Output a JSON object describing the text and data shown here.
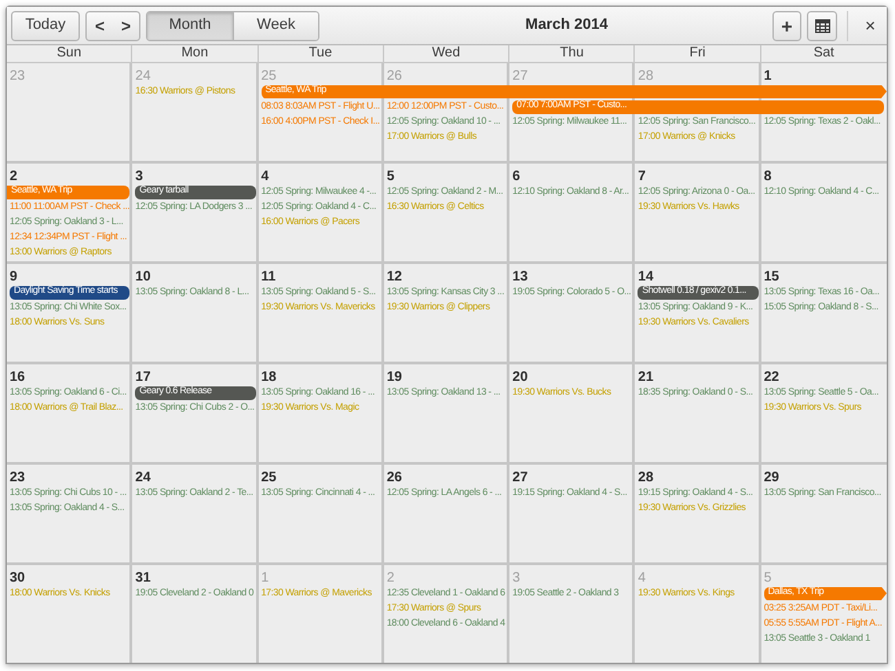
{
  "toolbar": {
    "today": "Today",
    "prev": "<",
    "next": ">",
    "views": [
      {
        "label": "Month",
        "selected": true
      },
      {
        "label": "Week",
        "selected": false
      }
    ],
    "title": "March 2014",
    "add": "+",
    "close": "×"
  },
  "weekdays": [
    "Sun",
    "Mon",
    "Tue",
    "Wed",
    "Thu",
    "Fri",
    "Sat"
  ],
  "weeks": [
    {
      "days": [
        {
          "date": "23",
          "in_month": false
        },
        {
          "date": "24",
          "in_month": false,
          "events": [
            {
              "kind": "line",
              "text": "16:30 Warriors @ Pistons",
              "color": "#c4a000"
            }
          ]
        },
        {
          "date": "25",
          "in_month": false,
          "events": [
            {
              "kind": "bar",
              "text": "Seattle, WA Trip",
              "color": "#f57900",
              "open_left": false,
              "arrow_right": true
            },
            {
              "kind": "line",
              "text": "08:03 8:03AM PST - Flight U...",
              "color": "#f57900"
            },
            {
              "kind": "line",
              "text": "16:00 4:00PM PST - Check I...",
              "color": "#f57900"
            }
          ]
        },
        {
          "date": "26",
          "in_month": false,
          "events": [
            {
              "kind": "continued"
            },
            {
              "kind": "line",
              "text": "12:00 12:00PM PST - Custo...",
              "color": "#f57900"
            },
            {
              "kind": "line",
              "text": "12:05 Spring: Oakland 10 - ...",
              "color": "#5f8c5f"
            },
            {
              "kind": "line",
              "text": "17:00 Warriors @ Bulls",
              "color": "#c4a000"
            }
          ]
        },
        {
          "date": "27",
          "in_month": false,
          "events": [
            {
              "kind": "continued"
            },
            {
              "kind": "bar",
              "text": "07:00 7:00AM PST - Custo...",
              "color": "#f57900",
              "open_left": false,
              "arrow_right": false
            },
            {
              "kind": "line",
              "text": "12:05 Spring: Milwaukee 11...",
              "color": "#5f8c5f"
            }
          ]
        },
        {
          "date": "28",
          "in_month": false,
          "events": [
            {
              "kind": "continued"
            },
            {
              "kind": "continued"
            },
            {
              "kind": "line",
              "text": "12:05 Spring: San Francisco...",
              "color": "#5f8c5f"
            },
            {
              "kind": "line",
              "text": "17:00 Warriors @ Knicks",
              "color": "#c4a000"
            }
          ]
        },
        {
          "date": "1",
          "in_month": true,
          "events": [
            {
              "kind": "continued"
            },
            {
              "kind": "continued"
            },
            {
              "kind": "line",
              "text": "12:05 Spring: Texas 2 - Oakl...",
              "color": "#5f8c5f"
            }
          ]
        }
      ]
    },
    {
      "days": [
        {
          "date": "2",
          "in_month": true,
          "events": [
            {
              "kind": "bar",
              "text": "Seattle, WA Trip",
              "color": "#f57900",
              "open_left": true,
              "arrow_right": false
            },
            {
              "kind": "line",
              "text": "11:00 11:00AM PST - Check ...",
              "color": "#f57900"
            },
            {
              "kind": "line",
              "text": "12:05 Spring: Oakland 3 - L...",
              "color": "#5f8c5f"
            },
            {
              "kind": "line",
              "text": "12:34 12:34PM PST - Flight ...",
              "color": "#f57900"
            },
            {
              "kind": "line",
              "text": "13:00 Warriors @ Raptors",
              "color": "#c4a000"
            }
          ]
        },
        {
          "date": "3",
          "in_month": true,
          "events": [
            {
              "kind": "bar",
              "text": "Geary tarball",
              "color": "#555753",
              "open_left": false,
              "arrow_right": false
            },
            {
              "kind": "line",
              "text": "12:05 Spring: LA Dodgers 3 ...",
              "color": "#5f8c5f"
            }
          ]
        },
        {
          "date": "4",
          "in_month": true,
          "events": [
            {
              "kind": "line",
              "text": "12:05 Spring: Milwaukee 4 -...",
              "color": "#5f8c5f"
            },
            {
              "kind": "line",
              "text": "12:05 Spring: Oakland 4 - C...",
              "color": "#5f8c5f"
            },
            {
              "kind": "line",
              "text": "16:00 Warriors @ Pacers",
              "color": "#c4a000"
            }
          ]
        },
        {
          "date": "5",
          "in_month": true,
          "events": [
            {
              "kind": "line",
              "text": "12:05 Spring: Oakland 2 - M...",
              "color": "#5f8c5f"
            },
            {
              "kind": "line",
              "text": "16:30 Warriors @ Celtics",
              "color": "#c4a000"
            }
          ]
        },
        {
          "date": "6",
          "in_month": true,
          "events": [
            {
              "kind": "line",
              "text": "12:10 Spring: Oakland 8 - Ar...",
              "color": "#5f8c5f"
            }
          ]
        },
        {
          "date": "7",
          "in_month": true,
          "events": [
            {
              "kind": "line",
              "text": "12:05 Spring: Arizona 0 - Oa...",
              "color": "#5f8c5f"
            },
            {
              "kind": "line",
              "text": "19:30 Warriors Vs. Hawks",
              "color": "#c4a000"
            }
          ]
        },
        {
          "date": "8",
          "in_month": true,
          "events": [
            {
              "kind": "line",
              "text": "12:10 Spring: Oakland 4 - C...",
              "color": "#5f8c5f"
            }
          ]
        }
      ]
    },
    {
      "days": [
        {
          "date": "9",
          "in_month": true,
          "events": [
            {
              "kind": "bar",
              "text": "Daylight Saving Time starts",
              "color": "#204a87",
              "open_left": false,
              "arrow_right": false
            },
            {
              "kind": "line",
              "text": "13:05 Spring: Chi White Sox...",
              "color": "#5f8c5f"
            },
            {
              "kind": "line",
              "text": "18:00 Warriors Vs. Suns",
              "color": "#c4a000"
            }
          ]
        },
        {
          "date": "10",
          "in_month": true,
          "events": [
            {
              "kind": "line",
              "text": "13:05 Spring: Oakland 8 - L...",
              "color": "#5f8c5f"
            }
          ]
        },
        {
          "date": "11",
          "in_month": true,
          "events": [
            {
              "kind": "line",
              "text": "13:05 Spring: Oakland 5 - S...",
              "color": "#5f8c5f"
            },
            {
              "kind": "line",
              "text": "19:30 Warriors Vs. Mavericks",
              "color": "#c4a000"
            }
          ]
        },
        {
          "date": "12",
          "in_month": true,
          "events": [
            {
              "kind": "line",
              "text": "13:05 Spring: Kansas City 3 ...",
              "color": "#5f8c5f"
            },
            {
              "kind": "line",
              "text": "19:30 Warriors @ Clippers",
              "color": "#c4a000"
            }
          ]
        },
        {
          "date": "13",
          "in_month": true,
          "events": [
            {
              "kind": "line",
              "text": "19:05 Spring: Colorado 5 - O...",
              "color": "#5f8c5f"
            }
          ]
        },
        {
          "date": "14",
          "in_month": true,
          "events": [
            {
              "kind": "bar",
              "text": "Shotwell 0.18 / gexiv2 0.1...",
              "color": "#555753",
              "open_left": false,
              "arrow_right": false
            },
            {
              "kind": "line",
              "text": "13:05 Spring: Oakland 9 - K...",
              "color": "#5f8c5f"
            },
            {
              "kind": "line",
              "text": "19:30 Warriors Vs. Cavaliers",
              "color": "#c4a000"
            }
          ]
        },
        {
          "date": "15",
          "in_month": true,
          "events": [
            {
              "kind": "line",
              "text": "13:05 Spring: Texas 16 - Oa...",
              "color": "#5f8c5f"
            },
            {
              "kind": "line",
              "text": "15:05 Spring: Oakland 8 - S...",
              "color": "#5f8c5f"
            }
          ]
        }
      ]
    },
    {
      "days": [
        {
          "date": "16",
          "in_month": true,
          "events": [
            {
              "kind": "line",
              "text": "13:05 Spring: Oakland 6 - Ci...",
              "color": "#5f8c5f"
            },
            {
              "kind": "line",
              "text": "18:00 Warriors @ Trail Blaz...",
              "color": "#c4a000"
            }
          ]
        },
        {
          "date": "17",
          "in_month": true,
          "events": [
            {
              "kind": "bar",
              "text": "Geary 0.6 Release",
              "color": "#555753",
              "open_left": false,
              "arrow_right": false
            },
            {
              "kind": "line",
              "text": "13:05 Spring: Chi Cubs 2 - O...",
              "color": "#5f8c5f"
            }
          ]
        },
        {
          "date": "18",
          "in_month": true,
          "events": [
            {
              "kind": "line",
              "text": "13:05 Spring: Oakland 16 - ...",
              "color": "#5f8c5f"
            },
            {
              "kind": "line",
              "text": "19:30 Warriors Vs. Magic",
              "color": "#c4a000"
            }
          ]
        },
        {
          "date": "19",
          "in_month": true,
          "events": [
            {
              "kind": "line",
              "text": "13:05 Spring: Oakland 13 - ...",
              "color": "#5f8c5f"
            }
          ]
        },
        {
          "date": "20",
          "in_month": true,
          "events": [
            {
              "kind": "line",
              "text": "19:30 Warriors Vs. Bucks",
              "color": "#c4a000"
            }
          ]
        },
        {
          "date": "21",
          "in_month": true,
          "events": [
            {
              "kind": "line",
              "text": "18:35 Spring: Oakland 0 - S...",
              "color": "#5f8c5f"
            }
          ]
        },
        {
          "date": "22",
          "in_month": true,
          "events": [
            {
              "kind": "line",
              "text": "13:05 Spring: Seattle 5 - Oa...",
              "color": "#5f8c5f"
            },
            {
              "kind": "line",
              "text": "19:30 Warriors Vs. Spurs",
              "color": "#c4a000"
            }
          ]
        }
      ]
    },
    {
      "days": [
        {
          "date": "23",
          "in_month": true,
          "events": [
            {
              "kind": "line",
              "text": "13:05 Spring: Chi Cubs 10 - ...",
              "color": "#5f8c5f"
            },
            {
              "kind": "line",
              "text": "13:05 Spring: Oakland 4 - S...",
              "color": "#5f8c5f"
            }
          ]
        },
        {
          "date": "24",
          "in_month": true,
          "events": [
            {
              "kind": "line",
              "text": "13:05 Spring: Oakland 2 - Te...",
              "color": "#5f8c5f"
            }
          ]
        },
        {
          "date": "25",
          "in_month": true,
          "events": [
            {
              "kind": "line",
              "text": "13:05 Spring: Cincinnati 4 - ...",
              "color": "#5f8c5f"
            }
          ]
        },
        {
          "date": "26",
          "in_month": true,
          "events": [
            {
              "kind": "line",
              "text": "12:05 Spring: LA Angels 6 - ...",
              "color": "#5f8c5f"
            }
          ]
        },
        {
          "date": "27",
          "in_month": true,
          "events": [
            {
              "kind": "line",
              "text": "19:15 Spring: Oakland 4 - S...",
              "color": "#5f8c5f"
            }
          ]
        },
        {
          "date": "28",
          "in_month": true,
          "events": [
            {
              "kind": "line",
              "text": "19:15 Spring: Oakland 4 - S...",
              "color": "#5f8c5f"
            },
            {
              "kind": "line",
              "text": "19:30 Warriors Vs. Grizzlies",
              "color": "#c4a000"
            }
          ]
        },
        {
          "date": "29",
          "in_month": true,
          "events": [
            {
              "kind": "line",
              "text": "13:05 Spring: San Francisco...",
              "color": "#5f8c5f"
            }
          ]
        }
      ]
    },
    {
      "days": [
        {
          "date": "30",
          "in_month": true,
          "events": [
            {
              "kind": "line",
              "text": "18:00 Warriors Vs. Knicks",
              "color": "#c4a000"
            }
          ]
        },
        {
          "date": "31",
          "in_month": true,
          "events": [
            {
              "kind": "line",
              "text": "19:05 Cleveland 2 - Oakland 0",
              "color": "#5f8c5f"
            }
          ]
        },
        {
          "date": "1",
          "in_month": false,
          "events": [
            {
              "kind": "line",
              "text": "17:30 Warriors @ Mavericks",
              "color": "#c4a000"
            }
          ]
        },
        {
          "date": "2",
          "in_month": false,
          "events": [
            {
              "kind": "line",
              "text": "12:35 Cleveland 1 - Oakland 6",
              "color": "#5f8c5f"
            },
            {
              "kind": "line",
              "text": "17:30 Warriors @ Spurs",
              "color": "#c4a000"
            },
            {
              "kind": "line",
              "text": "18:00 Cleveland 6 - Oakland 4",
              "color": "#5f8c5f"
            }
          ]
        },
        {
          "date": "3",
          "in_month": false,
          "events": [
            {
              "kind": "line",
              "text": "19:05 Seattle 2 - Oakland 3",
              "color": "#5f8c5f"
            }
          ]
        },
        {
          "date": "4",
          "in_month": false,
          "events": [
            {
              "kind": "line",
              "text": "19:30 Warriors Vs. Kings",
              "color": "#c4a000"
            }
          ]
        },
        {
          "date": "5",
          "in_month": false,
          "events": [
            {
              "kind": "bar",
              "text": "Dallas, TX Trip",
              "color": "#f57900",
              "open_left": false,
              "arrow_right": true
            },
            {
              "kind": "line",
              "text": "03:25 3:25AM PDT - Taxi/Li...",
              "color": "#f57900"
            },
            {
              "kind": "line",
              "text": "05:55 5:55AM PDT - Flight A...",
              "color": "#f57900"
            },
            {
              "kind": "line",
              "text": "13:05 Seattle 3 - Oakland 1",
              "color": "#5f8c5f"
            }
          ]
        }
      ]
    }
  ]
}
